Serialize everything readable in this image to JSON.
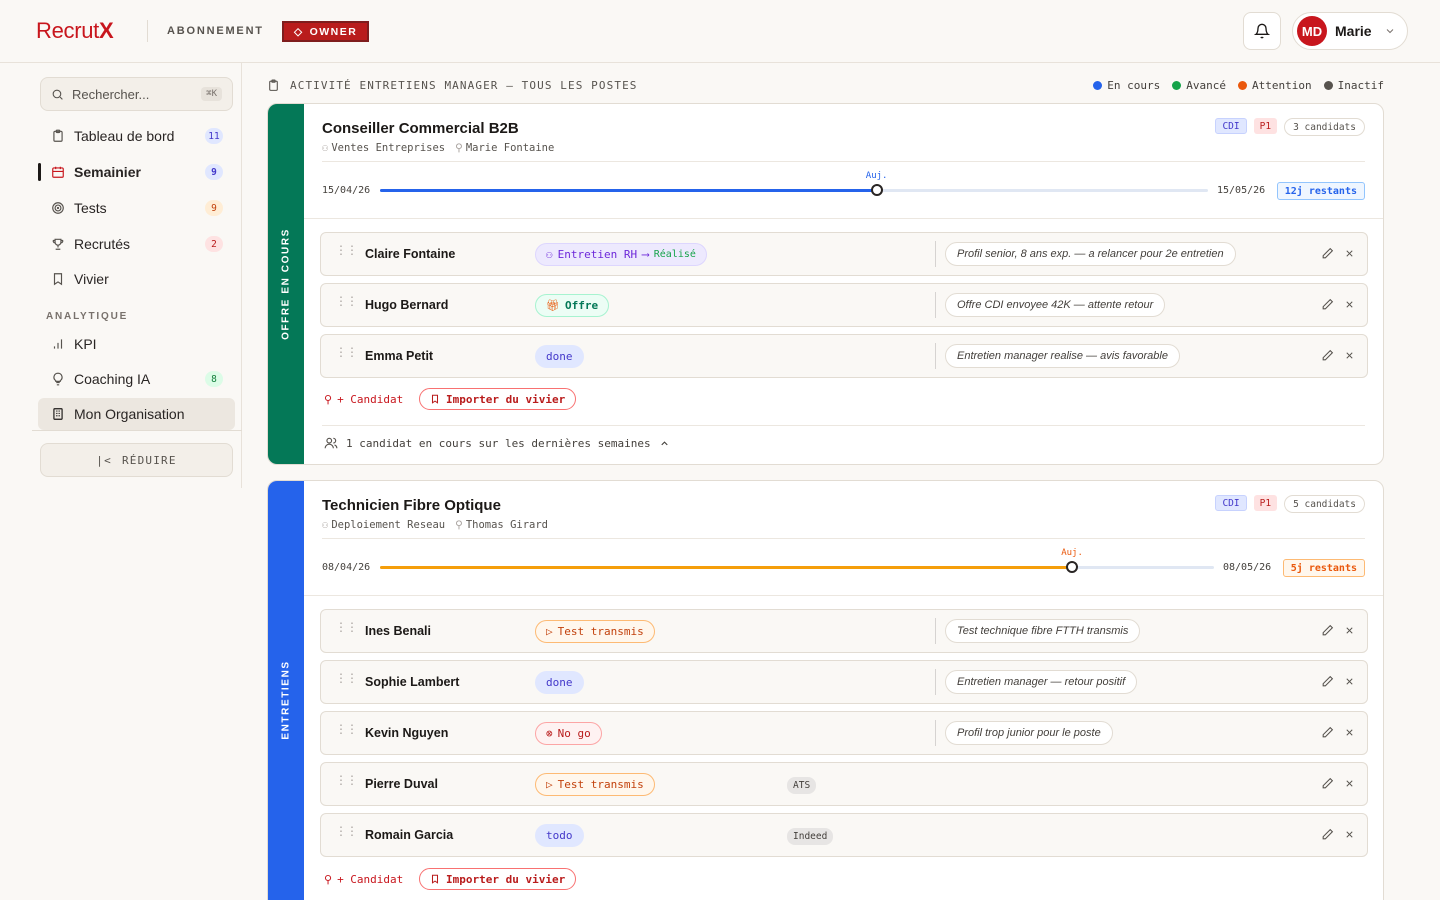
{
  "topbar": {
    "logo_main": "Recrut",
    "logo_x": "X",
    "section": "ABONNEMENT",
    "role_badge": "OWNER",
    "user_initials": "MD",
    "user_name": "Marie"
  },
  "sidebar": {
    "search_placeholder": "Rechercher...",
    "search_shortcut": "⌘K",
    "items": [
      {
        "label": "Tableau de bord",
        "badge": "11"
      },
      {
        "label": "Semainier",
        "badge": "9"
      },
      {
        "label": "Tests",
        "badge": "9"
      },
      {
        "label": "Recrutés",
        "badge": "2"
      },
      {
        "label": "Vivier",
        "badge": ""
      }
    ],
    "analytics_label": "ANALYTIQUE",
    "analytics_items": [
      {
        "label": "KPI",
        "badge": ""
      },
      {
        "label": "Coaching IA",
        "badge": "8"
      },
      {
        "label": "Mon Organisation",
        "badge": ""
      }
    ],
    "reduce_label": "RÉDUIRE"
  },
  "main": {
    "title": "ACTIVITÉ ENTRETIENS MANAGER — TOUS LES POSTES",
    "legend": [
      {
        "label": "En cours",
        "color": "#2563eb"
      },
      {
        "label": "Avancé",
        "color": "#16a34a"
      },
      {
        "label": "Attention",
        "color": "#ea580c"
      },
      {
        "label": "Inactif",
        "color": "#57534e"
      }
    ]
  },
  "cards": [
    {
      "rail_label": "OFFRE EN COURS",
      "rail_color": "#047857",
      "title": "Conseiller Commercial B2B",
      "department": "Ventes Entreprises",
      "manager": "Marie Fontaine",
      "tags": {
        "contract": "CDI",
        "priority": "P1",
        "count": "3 candidats"
      },
      "timeline": {
        "start": "15/04/26",
        "end": "15/05/26",
        "today_label": "Auj.",
        "progress": 0.6,
        "remaining": "12j restants",
        "color": "#2563eb"
      },
      "rows": [
        {
          "name": "Claire Fontaine",
          "status": "Entretien RH",
          "status_suffix": "Réalisé",
          "note": "Profil senior, 8 ans exp. — a relancer pour 2e entretien"
        },
        {
          "name": "Hugo Bernard",
          "status": "Offre",
          "note": "Offre CDI envoyee 42K — attente retour"
        },
        {
          "name": "Emma Petit",
          "status": "done",
          "note": "Entretien manager realise — avis favorable"
        }
      ],
      "add_label": "+ Candidat",
      "import_label": "Importer du vivier",
      "footer": "1 candidat en cours sur les dernières semaines"
    },
    {
      "rail_label": "ENTRETIENS",
      "rail_color": "#2563eb",
      "title": "Technicien Fibre Optique",
      "department": "Deploiement Reseau",
      "manager": "Thomas Girard",
      "tags": {
        "contract": "CDI",
        "priority": "P1",
        "count": "5 candidats"
      },
      "timeline": {
        "start": "08/04/26",
        "end": "08/05/26",
        "today_label": "Auj.",
        "progress": 0.83,
        "remaining": "5j restants",
        "color": "#f59e0b"
      },
      "rows": [
        {
          "name": "Ines Benali",
          "status": "Test transmis",
          "note": "Test technique fibre FTTH transmis"
        },
        {
          "name": "Sophie Lambert",
          "status": "done",
          "note": "Entretien manager — retour positif"
        },
        {
          "name": "Kevin Nguyen",
          "status": "No go",
          "note": "Profil trop junior pour le poste"
        },
        {
          "name": "Pierre Duval",
          "status": "Test transmis",
          "source": "ATS"
        },
        {
          "name": "Romain Garcia",
          "status": "todo",
          "source": "Indeed"
        }
      ],
      "add_label": "+ Candidat",
      "import_label": "Importer du vivier"
    }
  ]
}
